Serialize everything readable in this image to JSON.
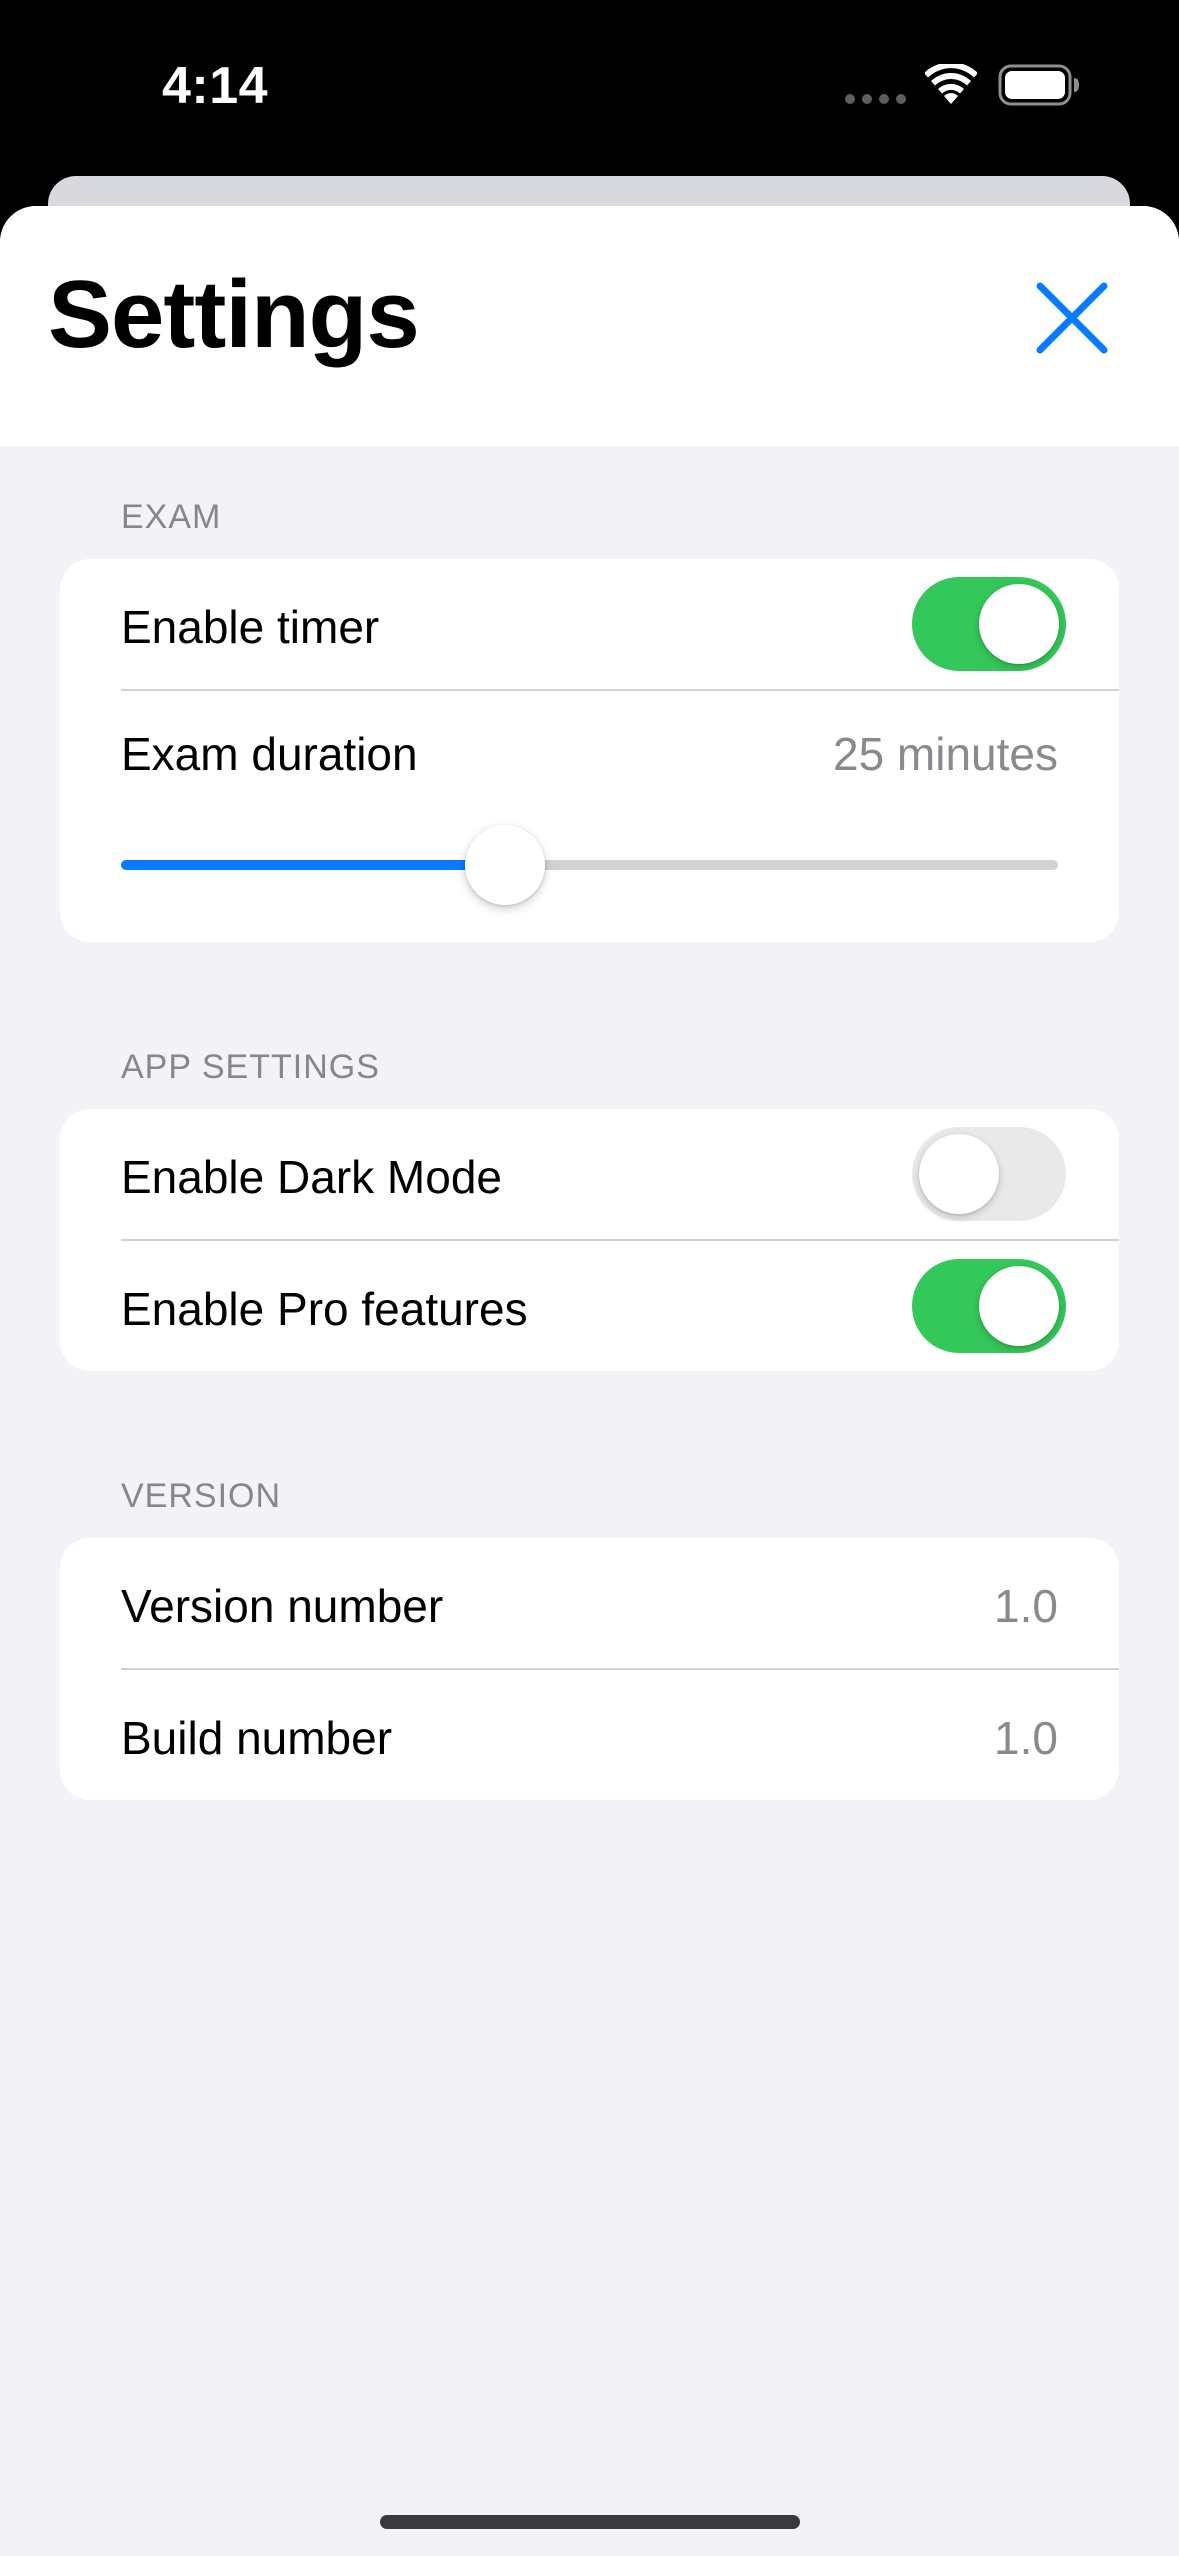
{
  "status_bar": {
    "time": "4:14"
  },
  "header": {
    "title": "Settings",
    "close_icon": "close-icon"
  },
  "sections": {
    "exam": {
      "header": "EXAM",
      "enable_timer": {
        "label": "Enable timer",
        "on": true
      },
      "exam_duration": {
        "label": "Exam duration",
        "value_text": "25 minutes",
        "slider_fraction": 0.41
      }
    },
    "app_settings": {
      "header": "APP SETTINGS",
      "dark_mode": {
        "label": "Enable Dark Mode",
        "on": false
      },
      "pro_features": {
        "label": "Enable Pro features",
        "on": true
      }
    },
    "version": {
      "header": "VERSION",
      "version_number": {
        "label": "Version number",
        "value": "1.0"
      },
      "build_number": {
        "label": "Build number",
        "value": "1.0"
      }
    }
  },
  "colors": {
    "accent": "#0a7aff",
    "toggle_on": "#34c759",
    "toggle_off": "#e9e9ea",
    "background": "#f2f2f7"
  }
}
